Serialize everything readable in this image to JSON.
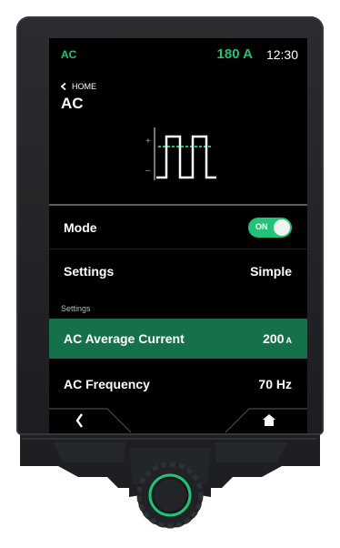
{
  "status": {
    "mode": "AC",
    "current": "180 A",
    "time": "12:30"
  },
  "nav": {
    "back_label": "HOME"
  },
  "page": {
    "title": "AC"
  },
  "rows": {
    "mode": {
      "label": "Mode",
      "toggle_label": "ON",
      "toggle_state": true
    },
    "settings": {
      "label": "Settings",
      "value": "Simple"
    }
  },
  "section": {
    "label": "Settings"
  },
  "params": {
    "avg_current": {
      "label": "AC Average Current",
      "value": "200",
      "unit": "A"
    },
    "frequency": {
      "label": "AC Frequency",
      "value": "70 Hz"
    }
  },
  "colors": {
    "accent": "#22c278",
    "selected_row": "#14714a",
    "screen_bg": "#000000",
    "housing": "#1f2124"
  },
  "icons": {
    "back": "chevron-left-icon",
    "home": "home-icon",
    "waveform": "ac-square-wave-icon"
  }
}
